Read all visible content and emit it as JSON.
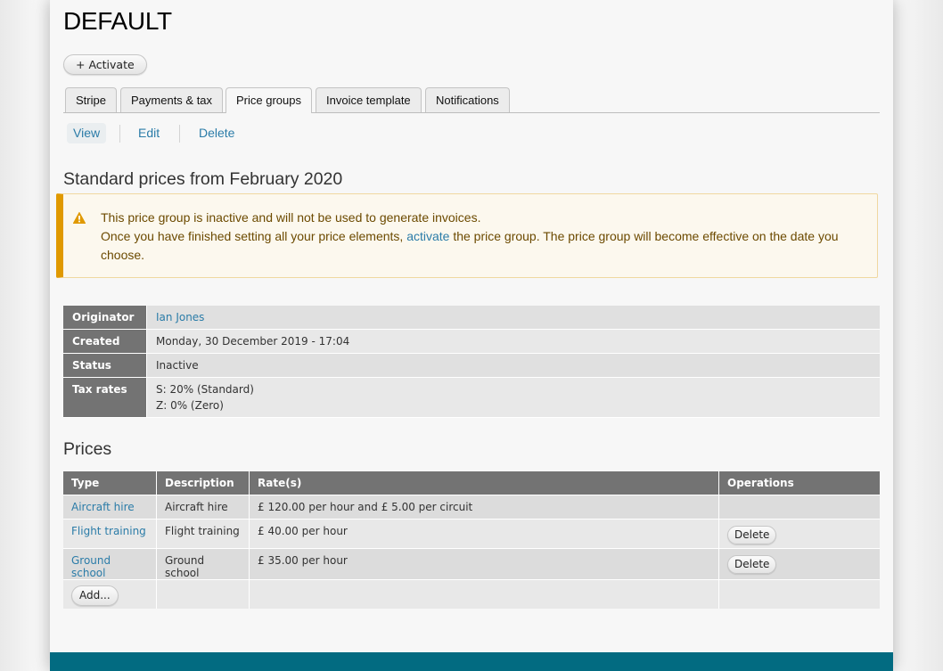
{
  "page": {
    "title": "DEFAULT",
    "activate_button": "+ Activate"
  },
  "tabs": [
    {
      "label": "Stripe",
      "active": false
    },
    {
      "label": "Payments & tax",
      "active": false
    },
    {
      "label": "Price groups",
      "active": true
    },
    {
      "label": "Invoice template",
      "active": false
    },
    {
      "label": "Notifications",
      "active": false
    }
  ],
  "subtabs": [
    {
      "label": "View",
      "active": true
    },
    {
      "label": "Edit",
      "active": false
    },
    {
      "label": "Delete",
      "active": false
    }
  ],
  "price_group": {
    "title": "Standard prices from February 2020"
  },
  "warning": {
    "icon": "warning-triangle-icon",
    "line1": "This price group is inactive and will not be used to generate invoices.",
    "line2_before": "Once you have finished setting all your price elements, ",
    "line2_link": "activate",
    "line2_after": " the price group. The price group will become effective on the date you choose."
  },
  "meta": {
    "originator_label": "Originator",
    "originator_value": "Ian Jones",
    "created_label": "Created",
    "created_value": "Monday, 30 December 2019 - 17:04",
    "status_label": "Status",
    "status_value": "Inactive",
    "tax_label": "Tax rates",
    "tax_rates": [
      "S: 20% (Standard)",
      "Z: 0% (Zero)"
    ]
  },
  "prices": {
    "title": "Prices",
    "headers": [
      "Type",
      "Description",
      "Rate(s)",
      "Operations"
    ],
    "rows": [
      {
        "type": "Aircraft hire",
        "description": "Aircraft hire",
        "rates": "£ 120.00 per hour and £ 5.00 per circuit",
        "operation": ""
      },
      {
        "type": "Flight training",
        "description": "Flight training",
        "rates": "£ 40.00 per hour",
        "operation": "Delete"
      },
      {
        "type": "Ground school",
        "description": "Ground school",
        "rates": "£ 35.00 per hour",
        "operation": "Delete"
      }
    ],
    "add_button": "Add..."
  },
  "colors": {
    "link": "#2b7ca8",
    "warning_accent": "#e09900",
    "footer": "#026b81",
    "table_header": "#737373"
  }
}
